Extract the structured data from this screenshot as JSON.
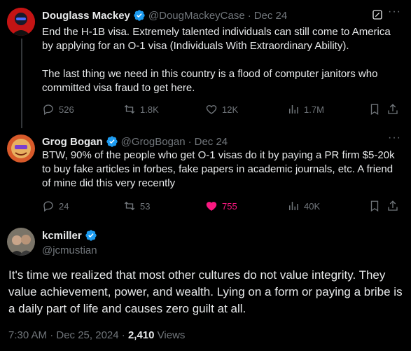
{
  "tweets": [
    {
      "name": "Douglass Mackey",
      "handle": "@DougMackeyCase",
      "date": "Dec 24",
      "text": "End the H-1B visa. Extremely talented individuals can still come to America by applying for an O-1 visa (Individuals With Extraordinary Ability).\n\nThe last thing we need in this country is a flood of computer janitors who committed visa fraud to get here.",
      "replies": "526",
      "retweets": "1.8K",
      "likes": "12K",
      "views": "1.7M"
    },
    {
      "name": "Grog Bogan",
      "handle": "@GrogBogan",
      "date": "Dec 24",
      "text": "BTW, 90% of the people who get O-1 visas do it by paying a PR firm $5-20k to buy fake articles in forbes, fake papers in academic journals, etc. A friend of mine did this very recently",
      "replies": "24",
      "retweets": "53",
      "likes": "755",
      "views": "40K"
    }
  ],
  "main": {
    "name": "kcmiller",
    "handle": "@jcmustian",
    "text": "It's time we realized that most other cultures do not value integrity. They value achievement, power, and wealth. Lying on a form or paying a bribe is a daily part of life and causes zero guilt at all.",
    "time": "7:30 AM · Dec 25, 2024 ·",
    "views_count": "2,410",
    "views_label": "Views"
  },
  "colors": {
    "accent": "#1d9bf0",
    "like": "#f91880",
    "muted": "#71767b"
  },
  "icons": [
    "verified-icon",
    "reply-icon",
    "retweet-icon",
    "like-icon",
    "views-icon",
    "bookmark-icon",
    "share-icon",
    "grok-icon",
    "more-icon"
  ]
}
